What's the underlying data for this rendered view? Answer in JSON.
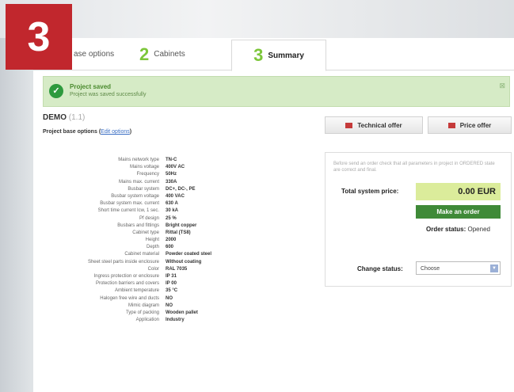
{
  "step_badge": "3",
  "tabs": [
    {
      "num": "",
      "label": "ase options"
    },
    {
      "num": "2",
      "label": "Cabinets"
    },
    {
      "num": "3",
      "label": "Summary"
    }
  ],
  "notice": {
    "title": "Project saved",
    "message": "Project was saved successfully",
    "close": "⊠"
  },
  "project": {
    "name": "DEMO",
    "version": "(1.1)",
    "base_label": "Project base options",
    "edit_link": "Edit options"
  },
  "offers": {
    "technical": "Technical offer",
    "price": "Price offer"
  },
  "panel": {
    "info": "Before send an order check that all parameters in project in ORDERED state are correct and final.",
    "total_label": "Total system price:",
    "total_value": "0.00 EUR",
    "order_button": "Make an order",
    "status_label": "Order status:",
    "status_value": "Opened",
    "change_label": "Change status:",
    "change_select": "Choose"
  },
  "specs": [
    {
      "k": "Mains network type",
      "v": "TN-C"
    },
    {
      "k": "Mains voltage",
      "v": "400V AC"
    },
    {
      "k": "Frequency",
      "v": "50Hz"
    },
    {
      "k": "Mains max. current",
      "v": "330A"
    },
    {
      "k": "Busbar system",
      "v": "DC+, DC-, PE"
    },
    {
      "k": "Busbar system voltage",
      "v": "400 VAC"
    },
    {
      "k": "Busbar system max. current",
      "v": "630 A"
    },
    {
      "k": "Short time current Icw, 1 sec.",
      "v": "30 kA"
    },
    {
      "k": "Pf design",
      "v": "25 %"
    },
    {
      "k": "Busbars and fittings",
      "v": "Bright copper"
    },
    {
      "k": "Cabinet type",
      "v": "Rittal (TS8)"
    },
    {
      "k": "Height",
      "v": "2000"
    },
    {
      "k": "Depth",
      "v": "600"
    },
    {
      "k": "Cabinet material",
      "v": "Powder coated steel"
    },
    {
      "k": "Sheet steel parts inside enclosure",
      "v": "Without coating"
    },
    {
      "k": "Color",
      "v": "RAL 7035"
    },
    {
      "k": "Ingress protection or enclosure",
      "v": "IP 31"
    },
    {
      "k": "Protection barriers and covers",
      "v": "IP 00"
    },
    {
      "k": "Ambient temperature",
      "v": "35 °C"
    },
    {
      "k": "Halogen free wire and ducts",
      "v": "NO"
    },
    {
      "k": "Mimic diagram",
      "v": "NO"
    },
    {
      "k": "Type of packing",
      "v": "Wooden pallet"
    },
    {
      "k": "Application",
      "v": "Industry"
    }
  ],
  "colors": {
    "badge": "#c1272d",
    "tab_number": "#7cc63a",
    "order_button": "#3f8a38",
    "price_box": "#dbec9b"
  }
}
